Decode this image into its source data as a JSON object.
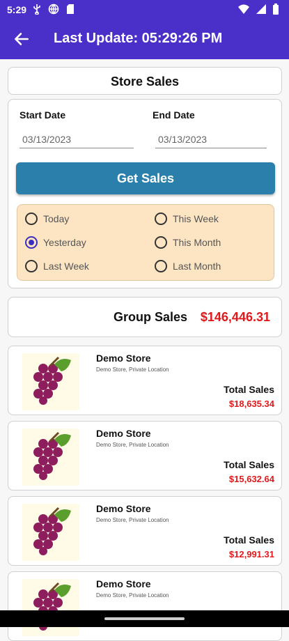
{
  "status_bar": {
    "time": "5:29",
    "icons": [
      "usb-icon",
      "globe-icon",
      "sd-card-icon",
      "wifi-icon",
      "signal-icon",
      "battery-icon"
    ]
  },
  "app_bar": {
    "title": "Last Update: 05:29:26 PM",
    "back_icon": "arrow-left-icon"
  },
  "store_sales": {
    "title": "Store Sales",
    "start_date": {
      "label": "Start Date",
      "value": "03/13/2023"
    },
    "end_date": {
      "label": "End Date",
      "value": "03/13/2023"
    },
    "get_sales_label": "Get Sales",
    "ranges": [
      {
        "label": "Today",
        "selected": false
      },
      {
        "label": "This Week",
        "selected": false
      },
      {
        "label": "Yesterday",
        "selected": true
      },
      {
        "label": "This Month",
        "selected": false
      },
      {
        "label": "Last Week",
        "selected": false
      },
      {
        "label": "Last Month",
        "selected": false
      }
    ]
  },
  "group_sales": {
    "label": "Group Sales",
    "value": "$146,446.31"
  },
  "stores": [
    {
      "name": "Demo Store",
      "location": "Demo Store, Private Location",
      "total_label": "Total Sales",
      "total": "$18,635.34"
    },
    {
      "name": "Demo Store",
      "location": "Demo Store, Private Location",
      "total_label": "Total Sales",
      "total": "$15,632.64"
    },
    {
      "name": "Demo Store",
      "location": "Demo Store, Private Location",
      "total_label": "Total Sales",
      "total": "$12,991.31"
    },
    {
      "name": "Demo Store",
      "location": "Demo Store, Private Location",
      "total_label": "",
      "total": ""
    }
  ],
  "colors": {
    "app_bar": "#4a2fc9",
    "button": "#2b80ab",
    "radio_panel": "#fde5c3",
    "sales_value": "#e0191c"
  }
}
